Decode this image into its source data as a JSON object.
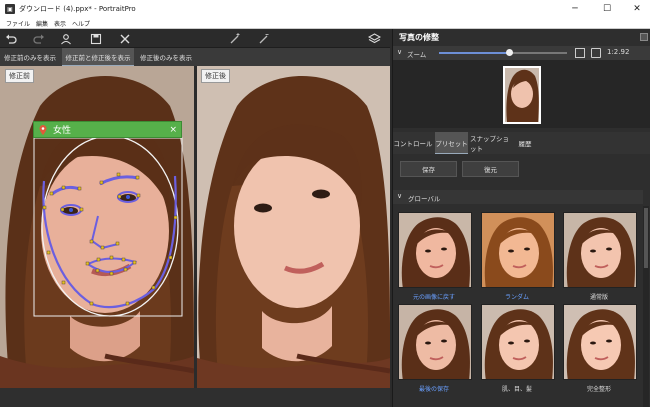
{
  "window": {
    "title": "ダウンロード (4).ppx* - PortraitPro",
    "minimize_icon": "minimize-icon",
    "maximize_icon": "maximize-icon",
    "close_icon": "close-icon"
  },
  "menu": [
    "ファイル",
    "編集",
    "表示",
    "ヘルプ"
  ],
  "toolbar": {
    "icons": [
      "undo-icon",
      "redo-icon",
      "person-icon",
      "save-icon",
      "close-icon",
      "wand-plus-icon",
      "wand-minus-icon",
      "layers-icon"
    ]
  },
  "view_tabs": [
    {
      "label": "修正前のみを表示",
      "active": false
    },
    {
      "label": "修正前と修正後を表示",
      "active": true
    },
    {
      "label": "修正後のみを表示",
      "active": false
    }
  ],
  "before_label": "修正前",
  "after_label": "修正後",
  "face_tag": {
    "label": "女性",
    "close": "×"
  },
  "side_panel": {
    "title": "写真の修整",
    "zoom_label": "ズーム",
    "zoom_level": 0.55,
    "zoom_ratio": "1:2.92",
    "tabs": [
      {
        "label": "コントロール",
        "active": false
      },
      {
        "label": "プリセット",
        "active": true
      },
      {
        "label": "スナップショット",
        "active": false
      },
      {
        "label": "履歴",
        "active": false
      }
    ],
    "save_button": "保存",
    "load_button": "復元",
    "section_label": "グローバル",
    "presets": [
      {
        "label": "元の画像に戻す",
        "color": "#6aa0ff"
      },
      {
        "label": "ランダム",
        "color": "#6aa0ff"
      },
      {
        "label": "通常版",
        "color": "#dddddd"
      },
      {
        "label": "最後の保存",
        "color": "#6aa0ff"
      },
      {
        "label": "肌、目、髪",
        "color": "#dddddd"
      },
      {
        "label": "完全整形",
        "color": "#dddddd"
      }
    ]
  },
  "colors": {
    "accent": "#6d8fd6",
    "tag_green": "#56b04a",
    "mesh": "#6b5fe0",
    "dot": "#e8c020"
  }
}
